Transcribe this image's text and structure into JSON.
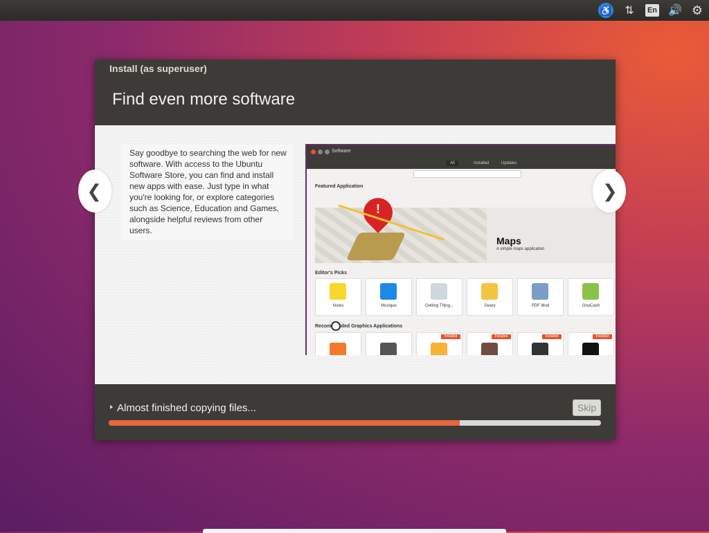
{
  "top_panel": {
    "icons": [
      "accessibility-icon",
      "network-icon",
      "keyboard-language-icon",
      "volume-icon",
      "settings-gear-icon"
    ],
    "language": "En"
  },
  "installer": {
    "window_title": "Install (as superuser)",
    "slide_heading": "Find even more software",
    "description": "Say goodbye to searching the web for new software. With access to the Ubuntu Software Store, you can find and install new apps with ease. Just type in what you're looking for, or explore categories such as Science, Education and Games, alongside helpful reviews from other users.",
    "prev_symbol": "❮",
    "next_symbol": "❯",
    "screenshot": {
      "title": "Software",
      "tabs": [
        "All",
        "Installed",
        "Updates"
      ],
      "featured_label": "Featured Application",
      "featured_app": {
        "name": "Maps",
        "subtitle": "A simple maps application"
      },
      "editors_picks_label": "Editor's Picks",
      "editors_picks": [
        {
          "name": "Notes",
          "color": "#f7d82c"
        },
        {
          "name": "Musique",
          "color": "#1e88e5"
        },
        {
          "name": "Getting Thing...",
          "color": "#cfd8dc"
        },
        {
          "name": "Geary",
          "color": "#f4c542"
        },
        {
          "name": "PDF Mod",
          "color": "#7e9cc8"
        },
        {
          "name": "GnuCash",
          "color": "#8bc34a"
        }
      ],
      "recommended_label": "Recommended Graphics Applications",
      "recommended_apps": [
        {
          "icon": "blender-icon",
          "color": "#f5792a",
          "badge": ""
        },
        {
          "icon": "paint-icon",
          "color": "#555555",
          "badge": ""
        },
        {
          "icon": "app-icon",
          "color": "#f9b233",
          "badge": "Installed"
        },
        {
          "icon": "gimp-icon",
          "color": "#6d4c41",
          "badge": "Installed"
        },
        {
          "icon": "scanner-icon",
          "color": "#333333",
          "badge": "Installed"
        },
        {
          "icon": "inkscape-icon",
          "color": "#111111",
          "badge": "Installed"
        }
      ]
    },
    "status": "Almost finished copying files...",
    "skip_label": "Skip",
    "progress": 0.713
  },
  "colors": {
    "accent": "#e9653b",
    "panel": "#3c3b37"
  }
}
